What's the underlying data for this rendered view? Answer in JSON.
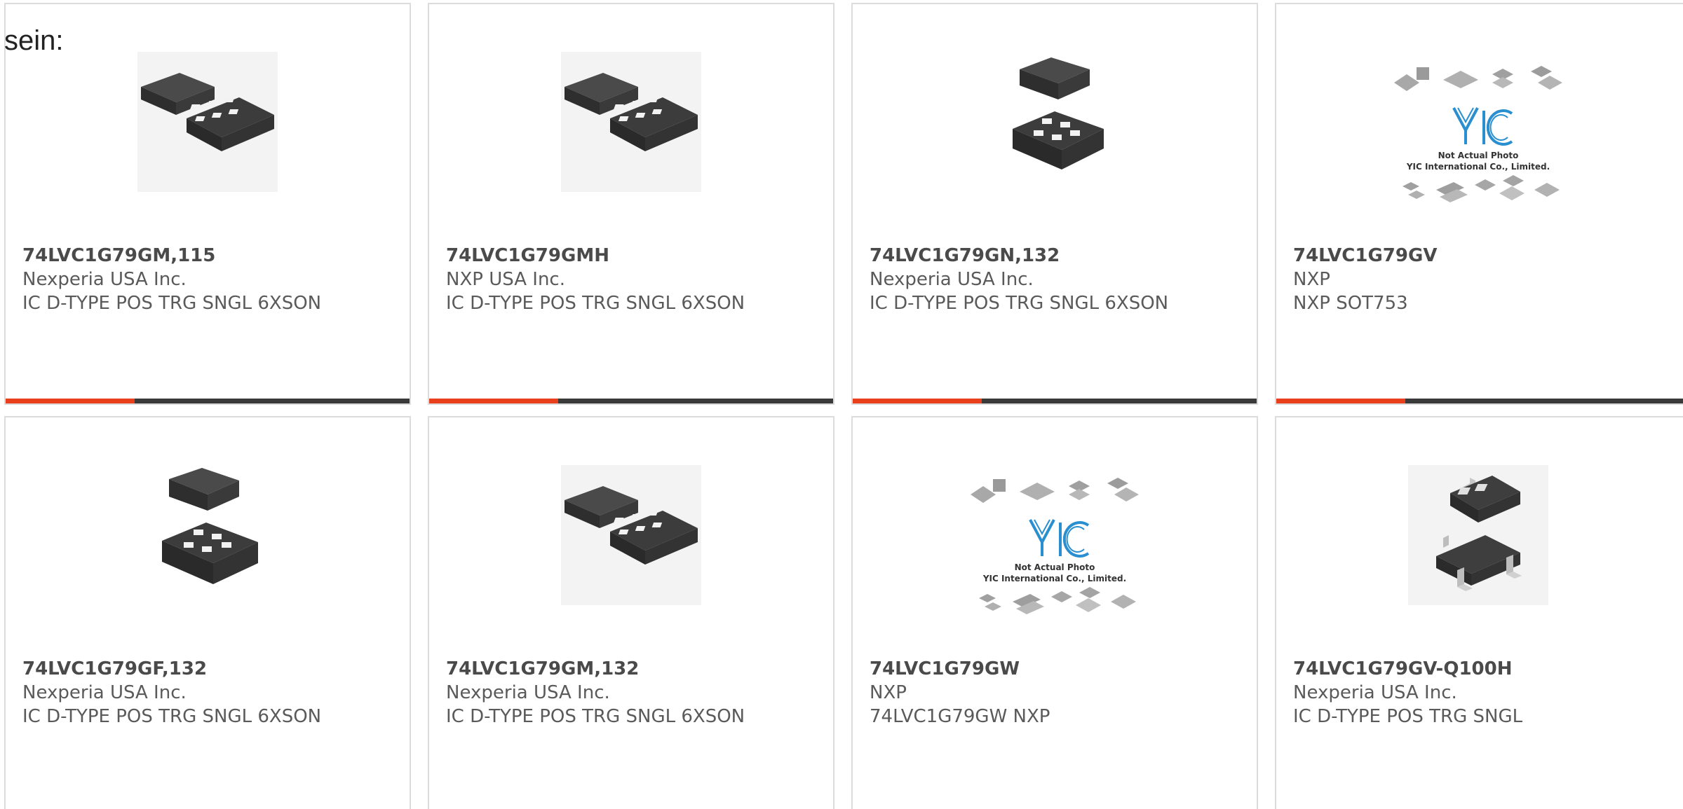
{
  "lead_text": "sein:",
  "colors": {
    "accent": "#e8401c",
    "bar": "#3a3a3a",
    "card_border": "#dcdcdc"
  },
  "products": [
    {
      "part_number": "74LVC1G79GM,115",
      "manufacturer": "Nexperia USA Inc.",
      "description": "IC D-TYPE POS TRG SNGL 6XSON",
      "image": "xson6-package-icon"
    },
    {
      "part_number": "74LVC1G79GMH",
      "manufacturer": "NXP USA Inc.",
      "description": "IC D-TYPE POS TRG SNGL 6XSON",
      "image": "xson6-package-icon"
    },
    {
      "part_number": "74LVC1G79GN,132",
      "manufacturer": "Nexperia USA Inc.",
      "description": "IC D-TYPE POS TRG SNGL 6XSON",
      "image": "xson6-package-icon"
    },
    {
      "part_number": "74LVC1G79GV",
      "manufacturer": "NXP",
      "description": "NXP SOT753",
      "image": "yic-placeholder",
      "placeholder_line1": "Not Actual Photo",
      "placeholder_line2": "YIC International Co., Limited."
    },
    {
      "part_number": "74LVC1G79GF,132",
      "manufacturer": "Nexperia USA Inc.",
      "description": "IC D-TYPE POS TRG SNGL 6XSON",
      "image": "xson6-package-icon"
    },
    {
      "part_number": "74LVC1G79GM,132",
      "manufacturer": "Nexperia USA Inc.",
      "description": "IC D-TYPE POS TRG SNGL 6XSON",
      "image": "xson6-package-icon"
    },
    {
      "part_number": "74LVC1G79GW",
      "manufacturer": "NXP",
      "description": "74LVC1G79GW NXP",
      "image": "yic-placeholder",
      "placeholder_line1": "Not Actual Photo",
      "placeholder_line2": "YIC International Co., Limited."
    },
    {
      "part_number": "74LVC1G79GV-Q100H",
      "manufacturer": "Nexperia USA Inc.",
      "description": "IC D-TYPE POS TRG SNGL",
      "image": "sot753-package-icon"
    }
  ]
}
